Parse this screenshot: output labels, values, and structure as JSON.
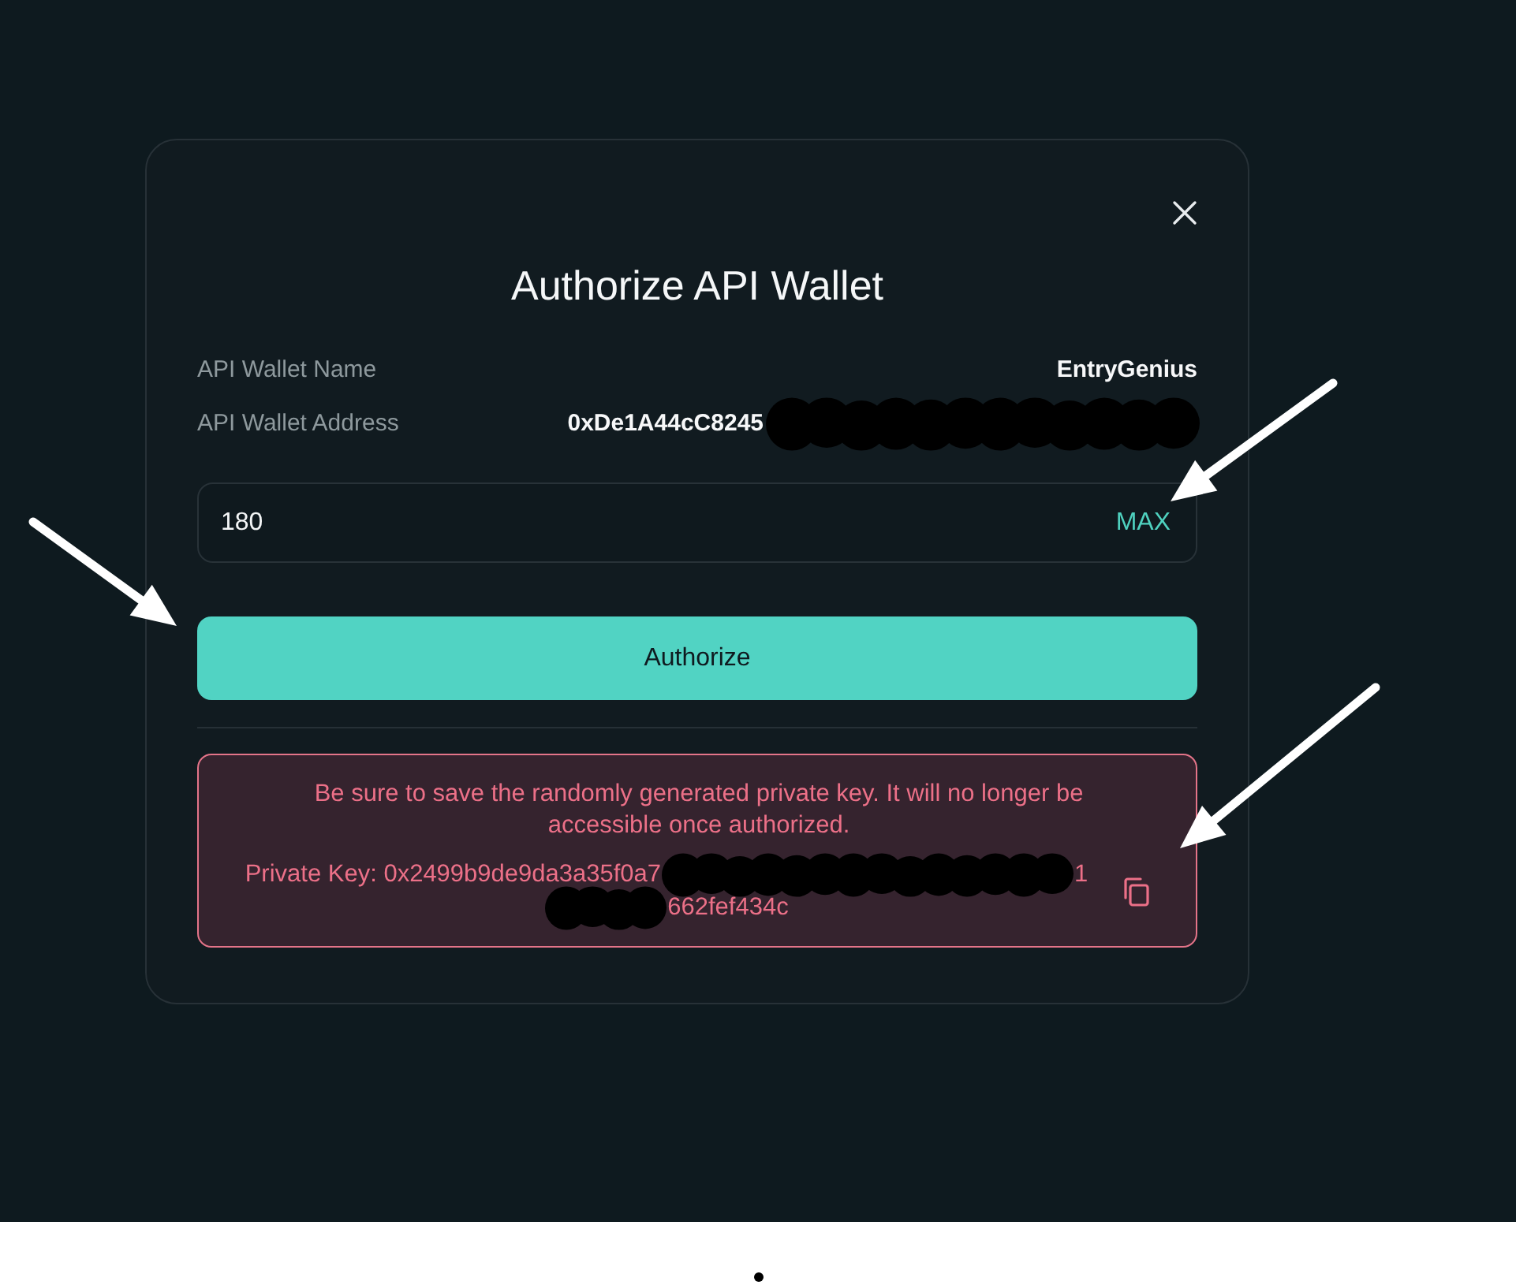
{
  "dialog": {
    "title": "Authorize API Wallet"
  },
  "fields": [
    {
      "label": "API Wallet Name",
      "value": "EntryGenius",
      "redacted": false
    },
    {
      "label": "API Wallet Address",
      "value": "0xDe1A44cC8245",
      "redacted": true
    }
  ],
  "amount_input": {
    "value": "180",
    "max_label": "MAX"
  },
  "primary_button": "Authorize",
  "warning": {
    "message": "Be sure to save the randomly generated private key. It will no longer be accessible once authorized.",
    "key_parts": [
      {
        "kind": "text",
        "text": "Private Key: 0x2499b9de9da3a35f0a7"
      },
      {
        "kind": "redacted"
      },
      {
        "kind": "text",
        "text": "1"
      },
      {
        "kind": "redacted"
      },
      {
        "kind": "text",
        "text": "662fef434c"
      }
    ]
  }
}
